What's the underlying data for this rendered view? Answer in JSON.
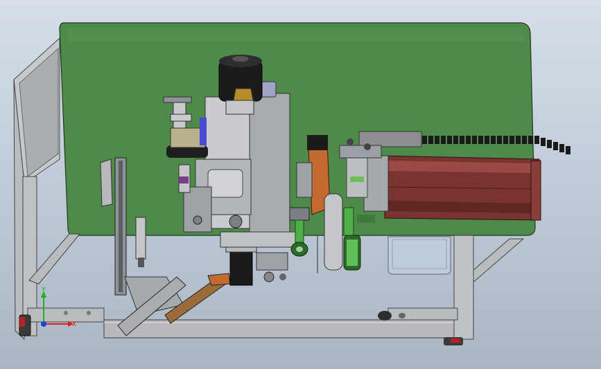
{
  "app": {
    "view": "cad-3d-model-viewport",
    "background_top": "#d6dfe8",
    "background_bottom": "#aab6c4"
  },
  "colors": {
    "table_top": "#4f8a4a",
    "frame": "#b7b9bc",
    "rail": "#7a3430",
    "motor": "#1b1b1b",
    "copper": "#c26a30",
    "cable_chain": "#1a1a1a"
  },
  "triad": {
    "y_label": "Y",
    "x_label": "X",
    "y_color": "#1fb31f",
    "x_color": "#e0201a",
    "z_color": "#2340d8"
  }
}
